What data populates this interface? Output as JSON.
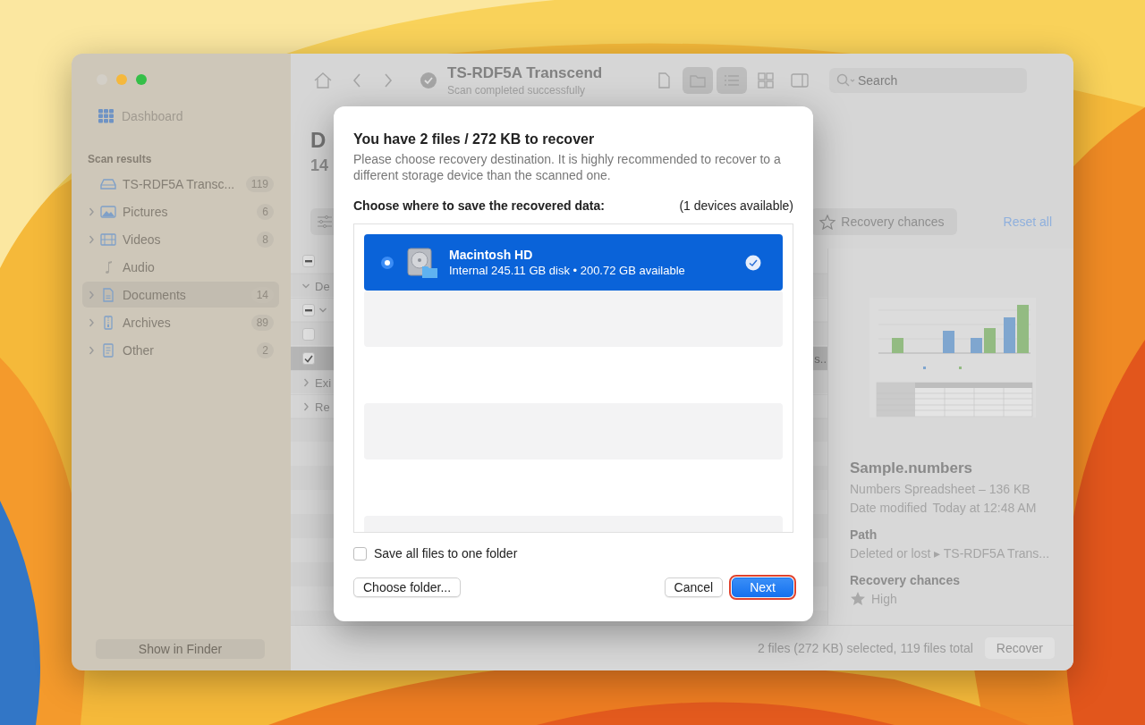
{
  "sidebar": {
    "dashboard": "Dashboard",
    "section_title": "Scan results",
    "items": [
      {
        "label": "TS-RDF5A Transc...",
        "count": "119",
        "expandable": false,
        "selected": false
      },
      {
        "label": "Pictures",
        "count": "6",
        "expandable": true,
        "selected": false
      },
      {
        "label": "Videos",
        "count": "8",
        "expandable": true,
        "selected": false
      },
      {
        "label": "Audio",
        "expandable": false,
        "selected": false
      },
      {
        "label": "Documents",
        "count": "14",
        "expandable": true,
        "selected": true
      },
      {
        "label": "Archives",
        "count": "89",
        "expandable": true,
        "selected": false
      },
      {
        "label": "Other",
        "count": "2",
        "expandable": true,
        "selected": false
      }
    ],
    "show_in_finder": "Show in Finder"
  },
  "toolbar": {
    "title": "TS-RDF5A Transcend",
    "subtitle": "Scan completed successfully",
    "search_placeholder": "Search",
    "view_buttons": [
      {
        "selected": false
      },
      {
        "selected": true
      },
      {
        "selected": true
      },
      {
        "selected": false
      },
      {
        "selected": false
      }
    ]
  },
  "content": {
    "heading": "D",
    "count": "14",
    "filter_button": "Recovery chances",
    "reset": "Reset all",
    "rows": [
      {
        "kind": "header",
        "checked": true,
        "indeterminate": true,
        "selected": false
      },
      {
        "kind": "group",
        "label": "De",
        "expanded": true,
        "selected": false
      },
      {
        "kind": "subgroup",
        "checked": true,
        "indeterminate": true,
        "expanded": true,
        "selected": false
      },
      {
        "kind": "file",
        "checked": false,
        "indeterminate": false,
        "selected": false
      },
      {
        "kind": "file",
        "checked": true,
        "indeterminate": false,
        "selected": true,
        "tail": "s.."
      },
      {
        "kind": "group",
        "label": "Exi",
        "expanded": false,
        "selected": false
      },
      {
        "kind": "group",
        "label": "Re",
        "expanded": false,
        "selected": false
      }
    ]
  },
  "preview": {
    "name": "Sample.numbers",
    "type_size": "Numbers Spreadsheet – 136 KB",
    "date_label": "Date modified",
    "date_value": "Today at 12:48 AM",
    "path_label": "Path",
    "path_value": "Deleted or lost ▸ TS-RDF5A Trans...",
    "chances_label": "Recovery chances",
    "chances_value": "High"
  },
  "status_bar": {
    "summary": "2 files (272 KB) selected, 119 files total",
    "recover": "Recover"
  },
  "dialog": {
    "title": "You have 2 files / 272 KB to recover",
    "message": "Please choose recovery destination. It is highly recommended to recover to a different storage device than the scanned one.",
    "prompt": "Choose where to save the recovered data:",
    "available": "(1 devices available)",
    "devices": [
      {
        "name": "Macintosh HD",
        "detail": "Internal 245.11 GB disk • 200.72 GB available",
        "selected": true
      }
    ],
    "save_to_one_folder": {
      "label": "Save all files to one folder",
      "checked": false
    },
    "buttons": [
      {
        "label": "Choose folder...",
        "kind": "plain",
        "highlighted": false
      },
      {
        "label": "Cancel",
        "kind": "plain",
        "highlighted": false
      },
      {
        "label": "Next",
        "kind": "primary",
        "highlighted": true
      }
    ]
  }
}
